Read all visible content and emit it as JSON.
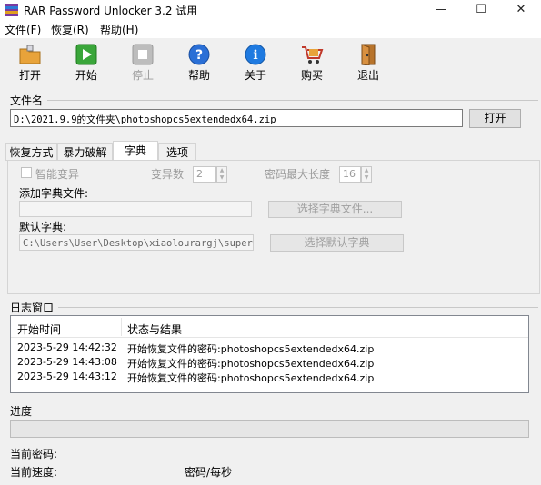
{
  "window": {
    "title": "RAR Password Unlocker 3.2 试用",
    "controls": {
      "minimize": "—",
      "maximize": "☐",
      "close": "✕"
    }
  },
  "menu": [
    "文件(F)",
    "恢复(R)",
    "帮助(H)"
  ],
  "toolbar": [
    {
      "label": "打开",
      "icon": "open-folder-icon",
      "enabled": true
    },
    {
      "label": "开始",
      "icon": "play-icon",
      "enabled": true
    },
    {
      "label": "停止",
      "icon": "stop-icon",
      "enabled": false
    },
    {
      "label": "帮助",
      "icon": "help-icon",
      "enabled": true
    },
    {
      "label": "关于",
      "icon": "info-icon",
      "enabled": true
    },
    {
      "label": "购买",
      "icon": "cart-icon",
      "enabled": true
    },
    {
      "label": "退出",
      "icon": "exit-door-icon",
      "enabled": true
    }
  ],
  "file": {
    "group_label": "文件名",
    "path": "D:\\2021.9.9的文件夹\\photoshopcs5extendedx64.zip",
    "open_button": "打开"
  },
  "tabs": [
    {
      "label": "恢复方式",
      "active": false
    },
    {
      "label": "暴力破解",
      "active": false
    },
    {
      "label": "字典",
      "active": true
    },
    {
      "label": "选项",
      "active": false
    }
  ],
  "dictionary": {
    "smart_mutation_label": "智能变异",
    "mutation_count_label": "变异数",
    "mutation_count_value": "2",
    "max_length_label": "密码最大长度",
    "max_length_value": "16",
    "add_dict_label": "添加字典文件:",
    "add_dict_value": "",
    "select_dict_button": "选择字典文件...",
    "default_dict_label": "默认字典:",
    "default_dict_value": "C:\\Users\\User\\Desktop\\xiaolourargj\\superdi",
    "select_default_button": "选择默认字典"
  },
  "log": {
    "group_label": "日志窗口",
    "columns": [
      "开始时间",
      "状态与结果"
    ],
    "rows": [
      [
        "2023-5-29 14:42:32",
        "开始恢复文件的密码:photoshopcs5extendedx64.zip"
      ],
      [
        "2023-5-29 14:43:08",
        "开始恢复文件的密码:photoshopcs5extendedx64.zip"
      ],
      [
        "2023-5-29 14:43:12",
        "开始恢复文件的密码:photoshopcs5extendedx64.zip"
      ]
    ]
  },
  "progress": {
    "group_label": "进度",
    "value": 0,
    "current_password_label": "当前密码:",
    "current_password_value": "",
    "current_speed_label": "当前速度:",
    "current_speed_unit": "密码/每秒"
  },
  "colors": {
    "title_bg": "#ffffff",
    "window_bg": "#f0f0f0",
    "play_green": "#3aa63a",
    "help_blue": "#2a6fd6",
    "info_blue": "#1f7ae0",
    "folder_orange": "#e8a33a"
  }
}
